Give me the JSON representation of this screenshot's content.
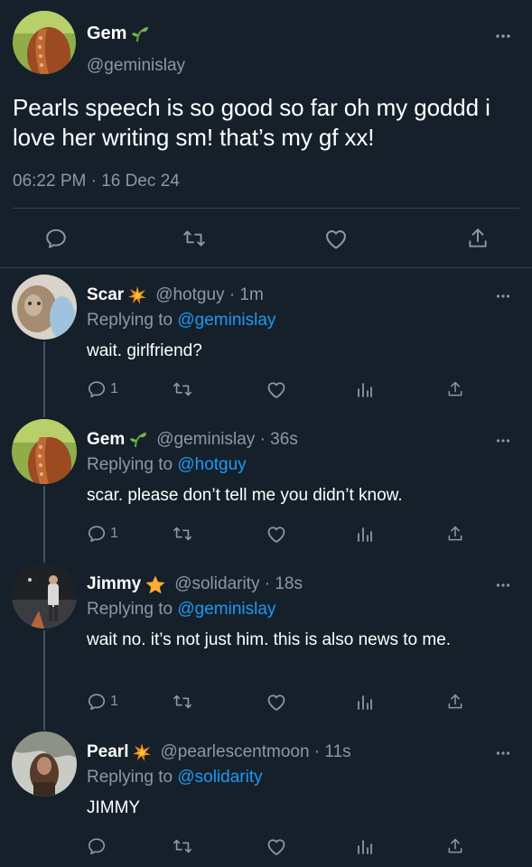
{
  "main_tweet": {
    "name": "Gem",
    "name_emoji": "seedling-emoji",
    "handle": "@geminislay",
    "text": "Pearls speech is so good so far oh my goddd i love her writing sm! that’s my gf xx!",
    "time": "06:22 PM",
    "dot": "·",
    "date": "16 Dec 24"
  },
  "replies": [
    {
      "name": "Scar",
      "name_emoji": "collision-emoji",
      "handle_line": "@hotguy · 1m",
      "replying_label": "Replying to",
      "replying_to": "@geminislay",
      "text": "wait. girlfriend?",
      "reply_count": "1"
    },
    {
      "name": "Gem",
      "name_emoji": "seedling-emoji",
      "handle_line": "@geminislay · 36s",
      "replying_label": "Replying to",
      "replying_to": "@hotguy",
      "text": "scar. please don’t tell me you didn’t know.",
      "reply_count": "1"
    },
    {
      "name": "Jimmy",
      "name_emoji": "star-emoji",
      "handle_line": "@solidarity · 18s",
      "replying_label": "Replying to",
      "replying_to": "@geminislay",
      "text": "wait no. it’s not just him. this is also news to me.",
      "reply_count": "1"
    },
    {
      "name": "Pearl",
      "name_emoji": "collision-emoji",
      "handle_line": "@pearlescentmoon · 11s",
      "replying_label": "Replying to",
      "replying_to": "@solidarity",
      "text": "JIMMY",
      "reply_count": ""
    }
  ],
  "colors": {
    "background": "#15202b",
    "text": "#ffffff",
    "muted": "#8b98a5",
    "link": "#1d9bf0",
    "divider": "#38444d"
  }
}
